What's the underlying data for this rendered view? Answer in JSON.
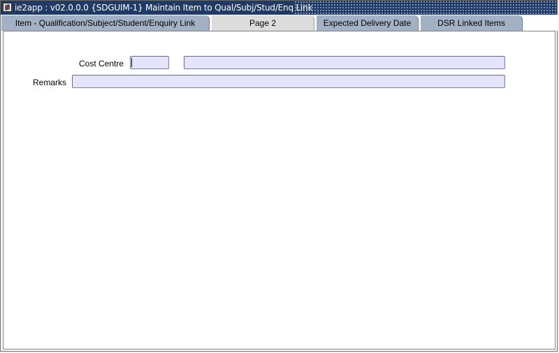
{
  "window": {
    "title": "ie2app : v02.0.0.0 {SDGUIM-1} Maintain Item to Qual/Subj/Stud/Enq Link"
  },
  "tabs": [
    {
      "label": "Item - Qualification/Subject/Student/Enquiry Link",
      "active": false
    },
    {
      "label": "Page 2",
      "active": true
    },
    {
      "label": "Expected Delivery Date",
      "active": false
    },
    {
      "label": "DSR Linked Items",
      "active": false
    }
  ],
  "form": {
    "cost_centre_label": "Cost Centre",
    "cost_centre_code": "",
    "cost_centre_description": "",
    "remarks_label": "Remarks",
    "remarks_value": ""
  },
  "colors": {
    "titlebar": "#1f3a66",
    "tab_inactive": "#a3b1c4",
    "tab_active": "#dcdcdc",
    "field_bg": "#e4e4fc"
  }
}
